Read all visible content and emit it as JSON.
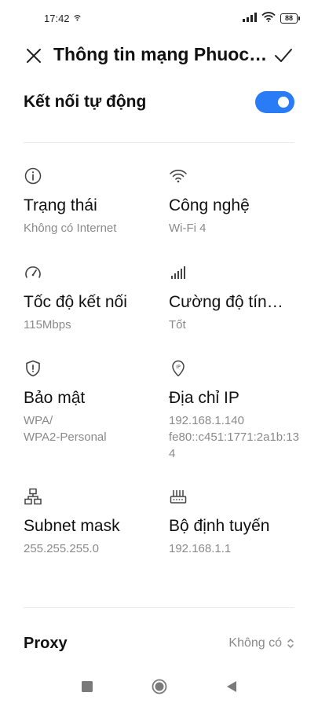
{
  "status_bar": {
    "time": "17:42",
    "battery": "88"
  },
  "header": {
    "title": "Thông tin mạng Phuoc…"
  },
  "auto_connect": {
    "label": "Kết nối tự động",
    "enabled": true
  },
  "info": {
    "status": {
      "title": "Trạng thái",
      "value": "Không có Internet",
      "icon": "info-icon"
    },
    "technology": {
      "title": "Công nghệ",
      "value": "Wi-Fi 4",
      "icon": "wifi-icon"
    },
    "link_speed": {
      "title": "Tốc độ kết nối",
      "value": "115Mbps",
      "icon": "speedometer-icon"
    },
    "signal_strength": {
      "title": "Cường độ tín…",
      "value": "Tốt",
      "icon": "signal-bars-icon"
    },
    "security": {
      "title": "Bảo mật",
      "value": "WPA/\nWPA2-Personal",
      "icon": "shield-icon"
    },
    "ip_address": {
      "title": "Địa chỉ IP",
      "value": "192.168.1.140\nfe80::c451:1771:2a1b:134",
      "icon": "ip-location-icon"
    },
    "subnet_mask": {
      "title": "Subnet mask",
      "value": "255.255.255.0",
      "icon": "network-topology-icon"
    },
    "router": {
      "title": "Bộ định tuyến",
      "value": "192.168.1.1",
      "icon": "router-icon"
    }
  },
  "proxy": {
    "label": "Proxy",
    "value": "Không có"
  },
  "colors": {
    "accent": "#2a7cf6",
    "secondary_text": "#8a8a8a"
  }
}
